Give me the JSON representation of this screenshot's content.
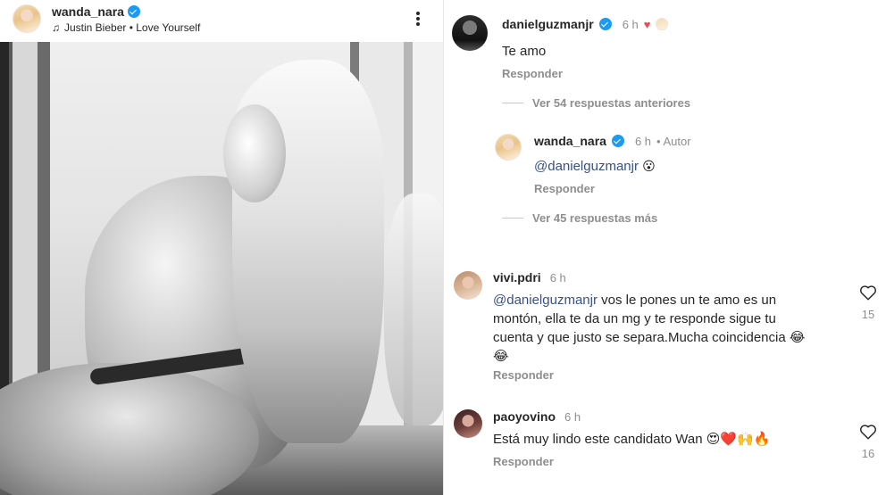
{
  "post": {
    "username": "wanda_nara",
    "music": "Justin Bieber • Love Yourself",
    "icons": [
      "verified-badge",
      "music-note-icon",
      "more-options-icon"
    ]
  },
  "comments": {
    "c1": {
      "username": "danielguzmanjr",
      "time": "6 h",
      "text": "Te amo",
      "reply": "Responder"
    },
    "view_previous": "Ver 54 respuestas anteriores",
    "c2": {
      "username": "wanda_nara",
      "time": "6 h",
      "author_tag": "• Autor",
      "mention": "@danielguzmanjr",
      "emoji": "😮",
      "reply": "Responder"
    },
    "view_more": "Ver 45 respuestas más",
    "c3": {
      "username": "vivi.pdri",
      "time": "6 h",
      "mention": "@danielguzmanjr",
      "text_line1": " vos le pones un te amo es un",
      "text_line2": "montón, ella te da un mg y te responde sigue tu",
      "text_line3": "cuenta y que justo se separa.Mucha coincidencia 😂",
      "text_line4": "😂",
      "reply": "Responder",
      "likes": "15"
    },
    "c4": {
      "username": "paoyovino",
      "time": "6 h",
      "text": "Está muy lindo este candidato Wan 😍❤️🙌🔥",
      "reply": "Responder",
      "likes": "16"
    }
  },
  "colors": {
    "link": "#385185",
    "muted": "#8e8e8e",
    "verified": "#1d9bf0",
    "heart": "#ed4956"
  }
}
